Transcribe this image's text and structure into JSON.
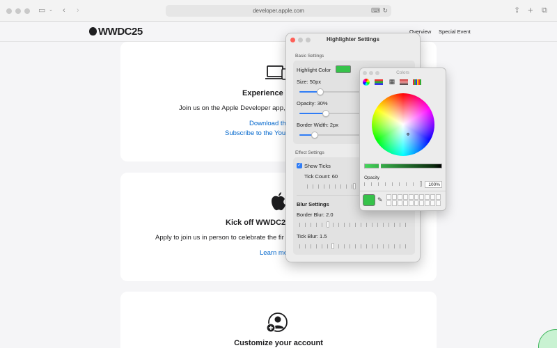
{
  "browser": {
    "url": "developer.apple.com",
    "sidebar_icon": "sidebar-icon",
    "back_icon": "chevron-left-icon",
    "forward_icon": "chevron-right-icon",
    "share_icon": "share-icon",
    "new_tab_icon": "plus-icon",
    "tabs_icon": "tabs-overview-icon"
  },
  "nav": {
    "logo": "WWDC25",
    "links": [
      "Overview",
      "Special Event"
    ]
  },
  "cards": [
    {
      "title": "Experience W",
      "text": "Join us on the Apple Developer app,",
      "links": [
        "Download th",
        "Subscribe to the You"
      ],
      "icon": "laptop-iphone-icon"
    },
    {
      "title": "Kick off WWDC25",
      "text": "Apply to join us in person to celebrate the fir",
      "links": [
        "Learn mo"
      ],
      "icon": "apple-logo-icon"
    },
    {
      "title": "Customize your account",
      "icon": "add-person-icon"
    }
  ],
  "highlighter": {
    "title": "Highlighter Settings",
    "basic_label": "Basic Settings",
    "color_label": "Highlight Color",
    "color": "#36c24a",
    "size_label": "Size: 50px",
    "size_value": 0.15,
    "opacity_label": "Opacity: 30%",
    "opacity_value": 0.3,
    "border_label": "Border Width: 2px",
    "border_value": 0.1,
    "effect_label": "Effect Settings",
    "show_ticks_label": "Show Ticks",
    "show_ticks": true,
    "tick_count_label": "Tick Count: 60",
    "blur_title": "Blur Settings",
    "border_blur_label": "Border Blur: 2.0",
    "tick_blur_label": "Tick Blur: 1.5"
  },
  "colors_panel": {
    "title": "Colors",
    "opacity_label": "Opacity",
    "opacity_value": "100%",
    "current_color": "#36c24a",
    "mode_icons": [
      "color-wheel-icon",
      "color-sliders-icon",
      "color-palettes-icon",
      "image-palettes-icon",
      "pencils-icon"
    ]
  }
}
